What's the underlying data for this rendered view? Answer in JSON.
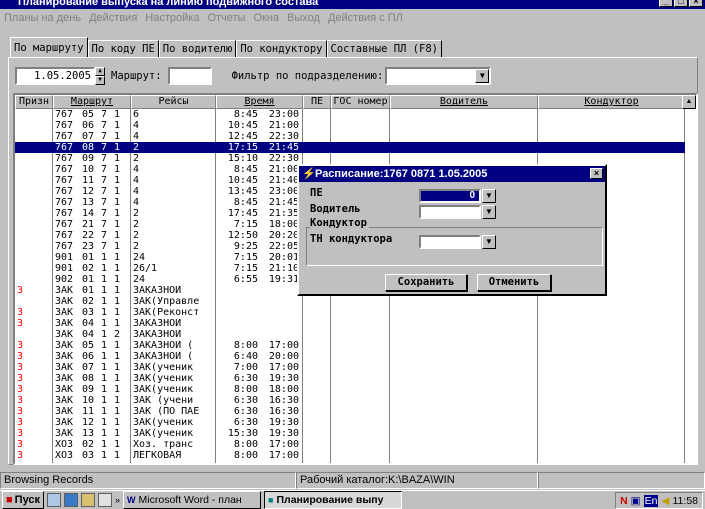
{
  "window": {
    "title": "Планирование выпуска на линию подвижного состава"
  },
  "menu": [
    "Планы на день",
    "Действия",
    "Настройка",
    "Отчеты",
    "Окна",
    "Выход",
    "Действия с ПЛ"
  ],
  "tabs": [
    "По маршруту",
    "По коду ПЕ",
    "По водителю",
    "По кондуктору",
    "Составные ПЛ (F8)"
  ],
  "filter": {
    "date": "1.05.2005",
    "route_label": "Маршрут:",
    "route_value": "",
    "division_label": "Фильтр по подразделению:",
    "division_value": ""
  },
  "grid": {
    "headers": [
      "Призн",
      "Маршрут",
      "Рейсы",
      "Время",
      "ПЕ",
      "ГОС номер",
      "Водитель",
      "Кондуктор"
    ],
    "rows": [
      {
        "p": "",
        "r1": "767",
        "r2": "05",
        "r3": "7",
        "r4": "1",
        "trip": "6",
        "t1": "8:45",
        "t2": "23:00"
      },
      {
        "p": "",
        "r1": "767",
        "r2": "06",
        "r3": "7",
        "r4": "1",
        "trip": "4",
        "t1": "10:45",
        "t2": "21:00"
      },
      {
        "p": "",
        "r1": "767",
        "r2": "07",
        "r3": "7",
        "r4": "1",
        "trip": "4",
        "t1": "12:45",
        "t2": "22:30"
      },
      {
        "p": "",
        "r1": "767",
        "r2": "08",
        "r3": "7",
        "r4": "1",
        "trip": "2",
        "t1": "17:15",
        "t2": "21:45",
        "sel": true
      },
      {
        "p": "",
        "r1": "767",
        "r2": "09",
        "r3": "7",
        "r4": "1",
        "trip": "2",
        "t1": "15:10",
        "t2": "22:30"
      },
      {
        "p": "",
        "r1": "767",
        "r2": "10",
        "r3": "7",
        "r4": "1",
        "trip": "4",
        "t1": "8:45",
        "t2": "21:00"
      },
      {
        "p": "",
        "r1": "767",
        "r2": "11",
        "r3": "7",
        "r4": "1",
        "trip": "4",
        "t1": "10:45",
        "t2": "21:40"
      },
      {
        "p": "",
        "r1": "767",
        "r2": "12",
        "r3": "7",
        "r4": "1",
        "trip": "4",
        "t1": "13:45",
        "t2": "23:00"
      },
      {
        "p": "",
        "r1": "767",
        "r2": "13",
        "r3": "7",
        "r4": "1",
        "trip": "4",
        "t1": "8:45",
        "t2": "21:45"
      },
      {
        "p": "",
        "r1": "767",
        "r2": "14",
        "r3": "7",
        "r4": "1",
        "trip": "2",
        "t1": "17:45",
        "t2": "21:35"
      },
      {
        "p": "",
        "r1": "767",
        "r2": "21",
        "r3": "7",
        "r4": "1",
        "trip": "2",
        "t1": "7:15",
        "t2": "18:00"
      },
      {
        "p": "",
        "r1": "767",
        "r2": "22",
        "r3": "7",
        "r4": "1",
        "trip": "2",
        "t1": "12:50",
        "t2": "20:20"
      },
      {
        "p": "",
        "r1": "767",
        "r2": "23",
        "r3": "7",
        "r4": "1",
        "trip": "2",
        "t1": "9:25",
        "t2": "22:05"
      },
      {
        "p": "",
        "r1": "901",
        "r2": "01",
        "r3": "1",
        "r4": "1",
        "trip": "24",
        "t1": "7:15",
        "t2": "20:01"
      },
      {
        "p": "",
        "r1": "901",
        "r2": "02",
        "r3": "1",
        "r4": "1",
        "trip": "26/1",
        "t1": "7:15",
        "t2": "21:10"
      },
      {
        "p": "",
        "r1": "902",
        "r2": "01",
        "r3": "1",
        "r4": "1",
        "trip": "24",
        "t1": "6:55",
        "t2": "19:31"
      },
      {
        "p": "З",
        "r1": "ЗАК",
        "r2": "01",
        "r3": "1",
        "r4": "1",
        "trip": "ЗАКАЗНОЙ",
        "t1": "",
        "t2": ""
      },
      {
        "p": "",
        "r1": "ЗАК",
        "r2": "02",
        "r3": "1",
        "r4": "1",
        "trip": "ЗАК(Управле",
        "t1": "",
        "t2": ""
      },
      {
        "p": "З",
        "r1": "ЗАК",
        "r2": "03",
        "r3": "1",
        "r4": "1",
        "trip": "ЗАК(Реконст",
        "t1": "",
        "t2": ""
      },
      {
        "p": "З",
        "r1": "ЗАК",
        "r2": "04",
        "r3": "1",
        "r4": "1",
        "trip": "ЗАКАЗНОЙ",
        "t1": "",
        "t2": ""
      },
      {
        "p": "",
        "r1": "ЗАК",
        "r2": "04",
        "r3": "1",
        "r4": "2",
        "trip": "ЗАКАЗНОЙ",
        "t1": "",
        "t2": ""
      },
      {
        "p": "З",
        "r1": "ЗАК",
        "r2": "05",
        "r3": "1",
        "r4": "1",
        "trip": "ЗАКАЗНОЙ (",
        "t1": "8:00",
        "t2": "17:00"
      },
      {
        "p": "З",
        "r1": "ЗАК",
        "r2": "06",
        "r3": "1",
        "r4": "1",
        "trip": "ЗАКАЗНОЙ (",
        "t1": "6:40",
        "t2": "20:00"
      },
      {
        "p": "З",
        "r1": "ЗАК",
        "r2": "07",
        "r3": "1",
        "r4": "1",
        "trip": "ЗАК(ученик",
        "t1": "7:00",
        "t2": "17:00"
      },
      {
        "p": "З",
        "r1": "ЗАК",
        "r2": "08",
        "r3": "1",
        "r4": "1",
        "trip": "ЗАК(ученик",
        "t1": "6:30",
        "t2": "19:30"
      },
      {
        "p": "З",
        "r1": "ЗАК",
        "r2": "09",
        "r3": "1",
        "r4": "1",
        "trip": "ЗАК(ученик",
        "t1": "8:00",
        "t2": "18:00"
      },
      {
        "p": "З",
        "r1": "ЗАК",
        "r2": "10",
        "r3": "1",
        "r4": "1",
        "trip": "ЗАК (учени",
        "t1": "6:30",
        "t2": "16:30"
      },
      {
        "p": "З",
        "r1": "ЗАК",
        "r2": "11",
        "r3": "1",
        "r4": "1",
        "trip": "ЗАК (ПО ПАЕ",
        "t1": "6:30",
        "t2": "16:30"
      },
      {
        "p": "З",
        "r1": "ЗАК",
        "r2": "12",
        "r3": "1",
        "r4": "1",
        "trip": "ЗАК(ученик",
        "t1": "6:30",
        "t2": "19:30"
      },
      {
        "p": "З",
        "r1": "ЗАК",
        "r2": "13",
        "r3": "1",
        "r4": "1",
        "trip": "ЗАК(ученик",
        "t1": "15:30",
        "t2": "19:30"
      },
      {
        "p": "З",
        "r1": "ХОЗ",
        "r2": "02",
        "r3": "1",
        "r4": "1",
        "trip": "Хоз. транс",
        "t1": "8:00",
        "t2": "17:00"
      },
      {
        "p": "З",
        "r1": "ХОЗ",
        "r2": "03",
        "r3": "1",
        "r4": "1",
        "trip": "ЛЕГКОВАЯ",
        "t1": "8:00",
        "t2": "17:00"
      }
    ]
  },
  "status": {
    "left": "Browsing Records",
    "mid": "",
    "catalog": "Рабочий каталог:K:\\BAZA\\WIN"
  },
  "taskbar": {
    "start": "Пуск",
    "tasks": [
      "Microsoft Word - план",
      "Планирование выпу"
    ],
    "clock": "11:58",
    "tray_lang": "En"
  },
  "dialog": {
    "title": "Расписание:1767 0871  1.05.2005",
    "pe_label": "ПЕ",
    "pe_value": "0",
    "driver_label": "Водитель",
    "conductor_group": "Кондуктор",
    "tn_label": "ТН кондуктора",
    "save": "Сохранить",
    "cancel": "Отменить"
  }
}
